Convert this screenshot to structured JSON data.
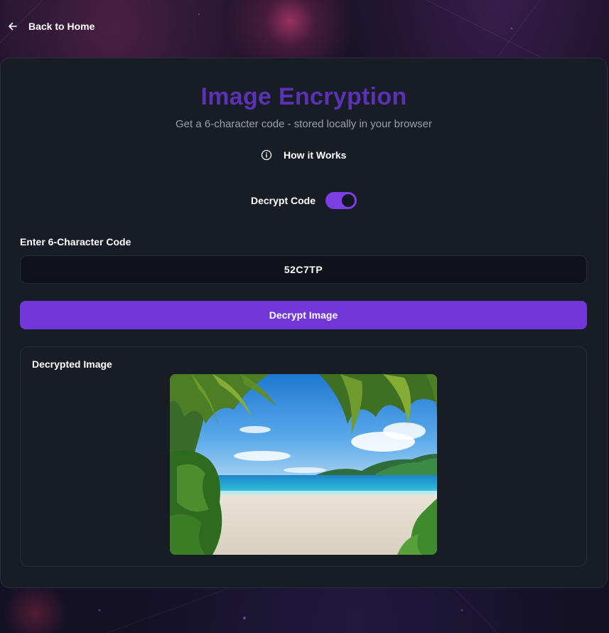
{
  "nav": {
    "back_label": "Back to Home",
    "back_icon": "arrow-left-icon"
  },
  "header": {
    "title": "Image Encryption",
    "subtitle": "Get a 6-character code - stored locally in your browser",
    "title_color": "#5b32b4"
  },
  "help": {
    "label": "How it Works",
    "icon": "info-icon"
  },
  "mode_toggle": {
    "label": "Decrypt Code",
    "checked": true,
    "color": "#7b3fe4"
  },
  "code_field": {
    "label": "Enter 6-Character Code",
    "value": "52C7TP"
  },
  "actions": {
    "decrypt_label": "Decrypt Image",
    "accent_color": "#7137d8"
  },
  "result": {
    "title": "Decrypted Image",
    "image_subject": "tropical-beach-with-palm-trees"
  }
}
